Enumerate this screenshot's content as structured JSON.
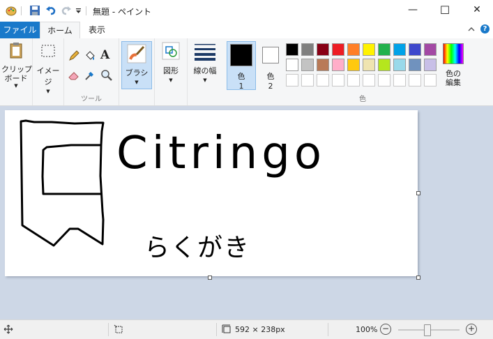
{
  "window": {
    "title": "無題 - ペイント",
    "controls": {
      "minimize": "—",
      "maximize": "☐",
      "close": "✕"
    }
  },
  "tabs": {
    "file": "ファイル",
    "home": "ホーム",
    "view": "表示"
  },
  "ribbon": {
    "clipboard": {
      "label": "クリップ\nボード"
    },
    "image": {
      "label": "イメージ"
    },
    "tools": {
      "group_label": "ツール"
    },
    "brush": {
      "label": "ブラシ"
    },
    "shapes": {
      "label": "図形"
    },
    "line_width": {
      "label": "線の幅"
    },
    "color1": {
      "label": "色",
      "num": "1",
      "value": "#000000"
    },
    "color2": {
      "label": "色",
      "num": "2",
      "value": "#ffffff"
    },
    "edit_colors": {
      "label": "色の\n編集"
    },
    "colors_group_label": "色",
    "palette": [
      [
        "#000000",
        "#7f7f7f",
        "#880015",
        "#ed1c24",
        "#ff7f27",
        "#fff200",
        "#22b14c",
        "#00a2e8",
        "#3f48cc",
        "#a349a4"
      ],
      [
        "#ffffff",
        "#c3c3c3",
        "#b97a57",
        "#ffaec9",
        "#ffc90e",
        "#efe4b0",
        "#b5e61d",
        "#99d9ea",
        "#7092be",
        "#c8bfe7"
      ],
      [
        "#ffffff",
        "#ffffff",
        "#ffffff",
        "#ffffff",
        "#ffffff",
        "#ffffff",
        "#ffffff",
        "#ffffff",
        "#ffffff",
        "#ffffff"
      ]
    ]
  },
  "canvas": {
    "drawing_text": "Citringo",
    "drawing_subtext": "らくがき"
  },
  "status": {
    "image_size": "592 × 238px",
    "zoom": "100%",
    "zoom_level": 1.0
  }
}
